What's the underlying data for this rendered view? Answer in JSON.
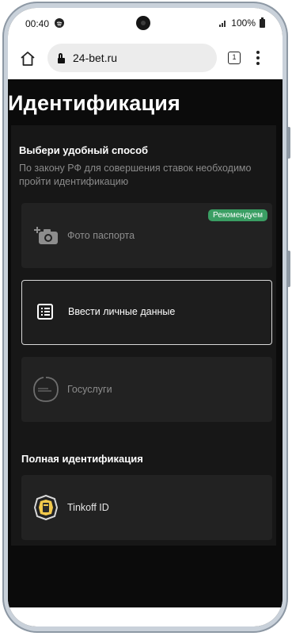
{
  "status_bar": {
    "time": "00:40",
    "battery": "100%",
    "icons": [
      "spotify-icon",
      "signal-icon",
      "battery-icon"
    ]
  },
  "browser": {
    "url": "24-bet.ru",
    "tab_count": "1",
    "icons": [
      "home-icon",
      "lock-icon",
      "menu-icon"
    ]
  },
  "page": {
    "title": "Идентификация",
    "section1_title": "Выбери удобный способ",
    "section1_desc": "По закону РФ для совершения ставок необходимо пройти идентификацию",
    "options": [
      {
        "label": "Фото паспорта",
        "badge": "Рекомендуем",
        "icon": "camera-add-icon"
      },
      {
        "label": "Ввести личные данные",
        "icon": "form-list-icon",
        "selected": true
      },
      {
        "label": "Госуслуги",
        "icon": "gosuslugi-logo-icon"
      }
    ],
    "section2_title": "Полная идентификация",
    "full_options": [
      {
        "label": "Tinkoff ID",
        "icon": "tinkoff-logo-icon"
      }
    ]
  },
  "colors": {
    "background": "#0b0b0b",
    "panel": "#171717",
    "card": "#222222",
    "badge": "#3a9e63",
    "text_muted": "#8a8a8a"
  }
}
